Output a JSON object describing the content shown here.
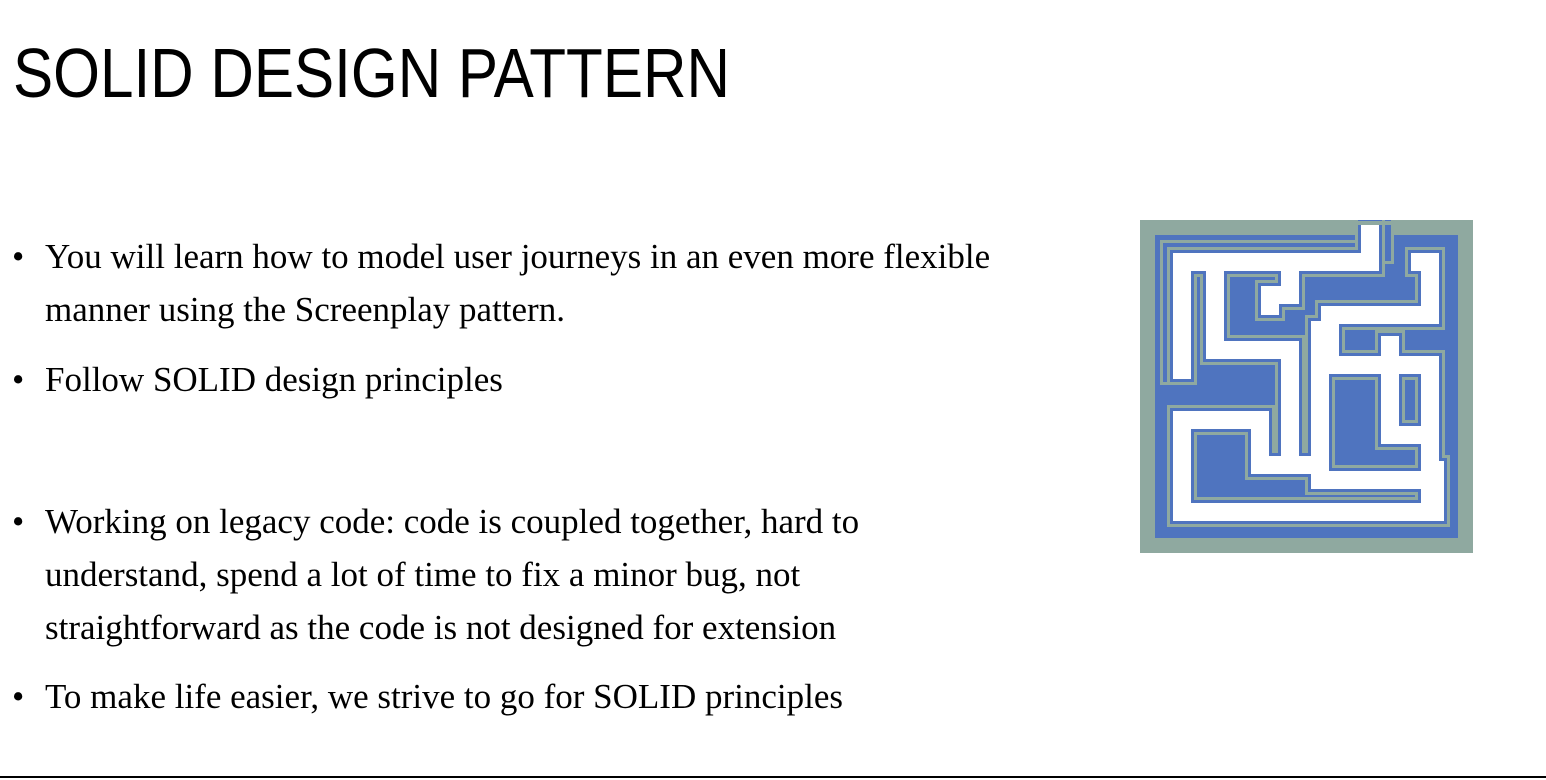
{
  "slide": {
    "title": "SOLID DESIGN PATTERN",
    "bullet_symbol": "•",
    "bullets": [
      "You will learn how to model user journeys in an even more flexible manner using the Screenplay pattern.",
      "Follow SOLID design principles",
      "Working on legacy code: code is coupled together, hard to understand, spend a lot of time to fix a minor bug, not straightforward as the code is not designed for extension",
      "To make life easier, we strive to go for SOLID principles"
    ]
  },
  "maze_image": {
    "icon": "maze-icon",
    "fill_color": "#4F74BF",
    "outline_color": "#8FA9A0"
  }
}
